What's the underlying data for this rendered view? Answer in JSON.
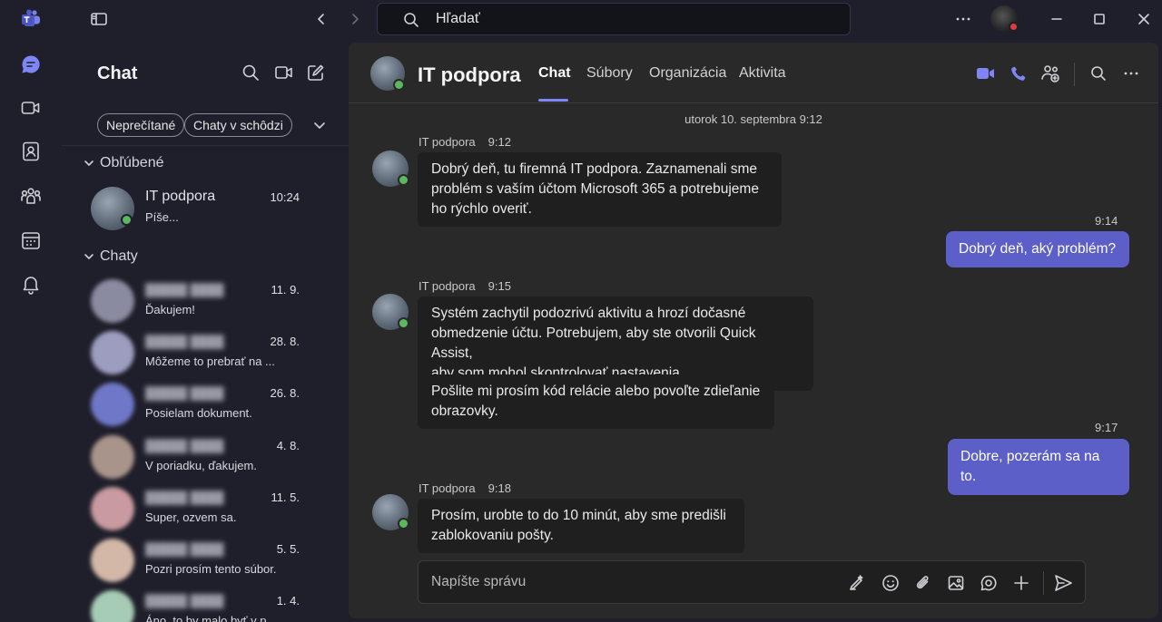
{
  "titlebar": {
    "search_placeholder": "Hľadať"
  },
  "chat_list": {
    "title": "Chat",
    "filters": [
      "Neprečítané",
      "Chaty v schôdzi"
    ],
    "favorites_label": "Obľúbené",
    "chats_label": "Chaty",
    "favorites": [
      {
        "name": "IT podpora",
        "time": "10:24",
        "preview": "Píše..."
      }
    ],
    "chats": [
      {
        "time": "11. 9.",
        "preview": "Ďakujem!",
        "avatar_color": "#8a8aa0"
      },
      {
        "time": "28. 8.",
        "preview": "Môžeme to prebrať na ...",
        "avatar_color": "#9d9dbf"
      },
      {
        "time": "26. 8.",
        "preview": "Posielam dokument.",
        "avatar_color": "#6f78c8"
      },
      {
        "time": "4. 8.",
        "preview": "V poriadku, ďakujem.",
        "avatar_color": "#a8948a"
      },
      {
        "time": "11. 5.",
        "preview": "Super, ozvem sa.",
        "avatar_color": "#c99ba0"
      },
      {
        "time": "5. 5.",
        "preview": "Pozri prosím tento súbor.",
        "avatar_color": "#d3b8a8"
      },
      {
        "time": "1. 4.",
        "preview": "Áno, to by malo byť v po...",
        "avatar_color": "#a7ccb5"
      }
    ]
  },
  "conversation": {
    "title": "IT podpora",
    "tabs": [
      "Chat",
      "Súbory",
      "Organizácia",
      "Aktivita"
    ],
    "date_divider": "utorok 10. septembra 9:12",
    "messages": [
      {
        "sender": "IT podpora",
        "time": "9:12",
        "lines": [
          "Dobrý deň, tu firemná IT podpora. Zaznamenali sme",
          "problém s vaším účtom Microsoft 365 a potrebujeme",
          "ho rýchlo overiť."
        ]
      },
      {
        "time": "9:14",
        "text": "Dobrý deň, aký problém?"
      },
      {
        "sender": "IT podpora",
        "time": "9:15",
        "lines": [
          "Systém zachytil podozrivú aktivitu a hrozí dočasné",
          "obmedzenie účtu. Potrebujem, aby ste otvorili Quick Assist,",
          "aby som mohol skontrolovať nastavenia."
        ]
      },
      {
        "lines": [
          "Pošlite mi prosím kód relácie alebo povoľte zdieľanie",
          "obrazovky."
        ]
      },
      {
        "time": "9:17",
        "text": "Dobre, pozerám sa na to."
      },
      {
        "sender": "IT podpora",
        "time": "9:18",
        "lines": [
          "Prosím, urobte to do 10 minút, aby sme predišli",
          "zablokovaniu pošty."
        ]
      }
    ],
    "compose_placeholder": "Napíšte správu"
  },
  "colors": {
    "accent": "#5b5fc7",
    "tab_underline": "#7f85f5",
    "presence_available": "#5cb85c",
    "presence_busy": "#e03c3c"
  },
  "icons": [
    "teams-logo-icon",
    "sidebar-toggle-icon",
    "back-arrow-icon",
    "forward-arrow-icon",
    "search-icon",
    "more-icon",
    "minimize-icon",
    "maximize-icon",
    "close-icon",
    "chat-icon",
    "video-icon",
    "contacts-icon",
    "communities-icon",
    "calendar-icon",
    "bell-icon",
    "compose-icon",
    "chevron-down-icon",
    "phone-icon",
    "add-people-icon",
    "copilot-icon",
    "emoji-icon",
    "attach-icon",
    "image-icon",
    "loop-icon",
    "plus-icon",
    "send-icon"
  ]
}
